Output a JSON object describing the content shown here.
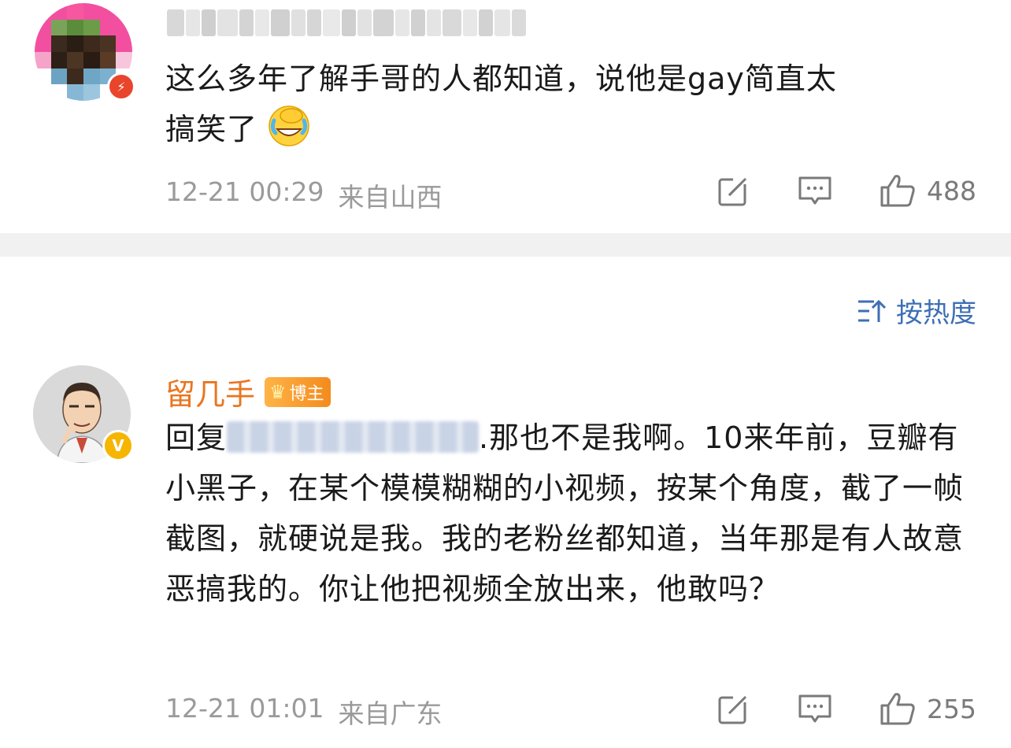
{
  "comment1": {
    "text_line1": "这么多年了解手哥的人都知道，说他是gay简直太",
    "text_line2": "搞笑了",
    "emoji": "laugh-cry-emoji",
    "time": "12-21 00:29",
    "location": "来自山西",
    "like_count": "488"
  },
  "sort": {
    "label": "按热度",
    "icon": "sort-icon"
  },
  "comment2": {
    "username": "留几手",
    "badge_label": "博主",
    "reply_prefix": "回复",
    "text": ".那也不是我啊。10来年前，豆瓣有小黑子，在某个模模糊糊的小视频，按某个角度，截了一帧截图，就硬说是我。我的老粉丝都知道，当年那是有人故意恶搞我的。你让他把视频全放出来，他敢吗？",
    "time": "12-21 01:01",
    "location": "来自广东",
    "like_count": "255"
  },
  "colors": {
    "username": "#ea7520",
    "link_blue": "#3d6fb5",
    "meta_gray": "#9a9a9a",
    "verified_yellow": "#f6b500"
  }
}
